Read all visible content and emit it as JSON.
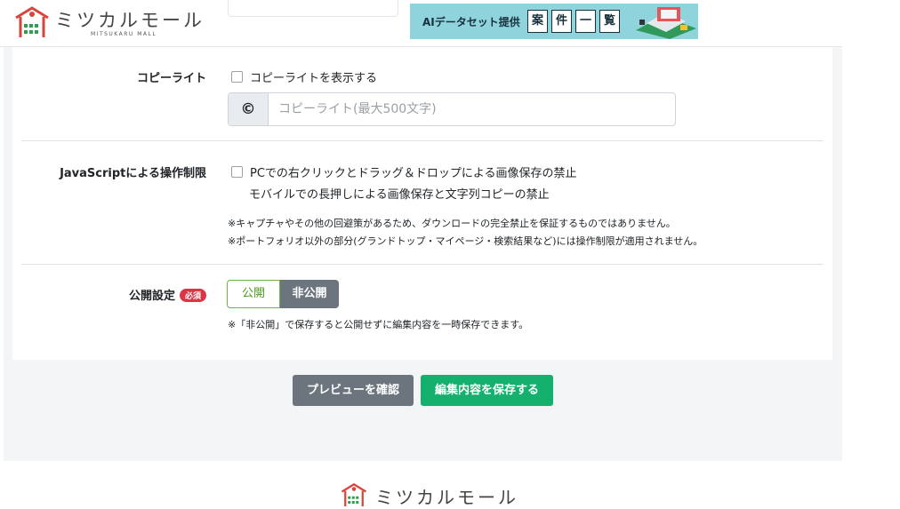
{
  "header": {
    "logo_text": "ミツカルモール",
    "logo_sub": "MITSUKARU MALL",
    "banner": {
      "text": "AIデータセット提供",
      "boxes": [
        "案",
        "件",
        "一",
        "覧"
      ]
    }
  },
  "form": {
    "copyright": {
      "label": "コピーライト",
      "checkbox_label": "コピーライトを表示する",
      "addon": "©",
      "placeholder": "コピーライト(最大500文字)"
    },
    "js_restriction": {
      "label": "JavaScriptによる操作制限",
      "checkbox_line1": "PCでの右クリックとドラッグ＆ドロップによる画像保存の禁止",
      "checkbox_line2": "モバイルでの長押しによる画像保存と文字列コピーの禁止",
      "note1": "※キャプチャやその他の回避策があるため、ダウンロードの完全禁止を保証するものではありません。",
      "note2": "※ポートフォリオ以外の部分(グランドトップ・マイページ・検索結果など)には操作制限が適用されません。"
    },
    "publish": {
      "label": "公開設定",
      "badge": "必須",
      "option_public": "公開",
      "option_private": "非公開",
      "note": "※「非公開」で保存すると公開せずに編集内容を一時保存できます。"
    }
  },
  "actions": {
    "preview_label": "プレビューを確認",
    "save_label": "編集内容を保存する"
  },
  "footer": {
    "logo_text": "ミツカルモール"
  },
  "colors": {
    "brand_red": "#d8453a",
    "brand_green": "#2e9e4f",
    "save_green": "#14b06e",
    "preview_gray": "#6c757d",
    "required_red": "#dc3545",
    "banner_bg": "#8fd4dc"
  }
}
